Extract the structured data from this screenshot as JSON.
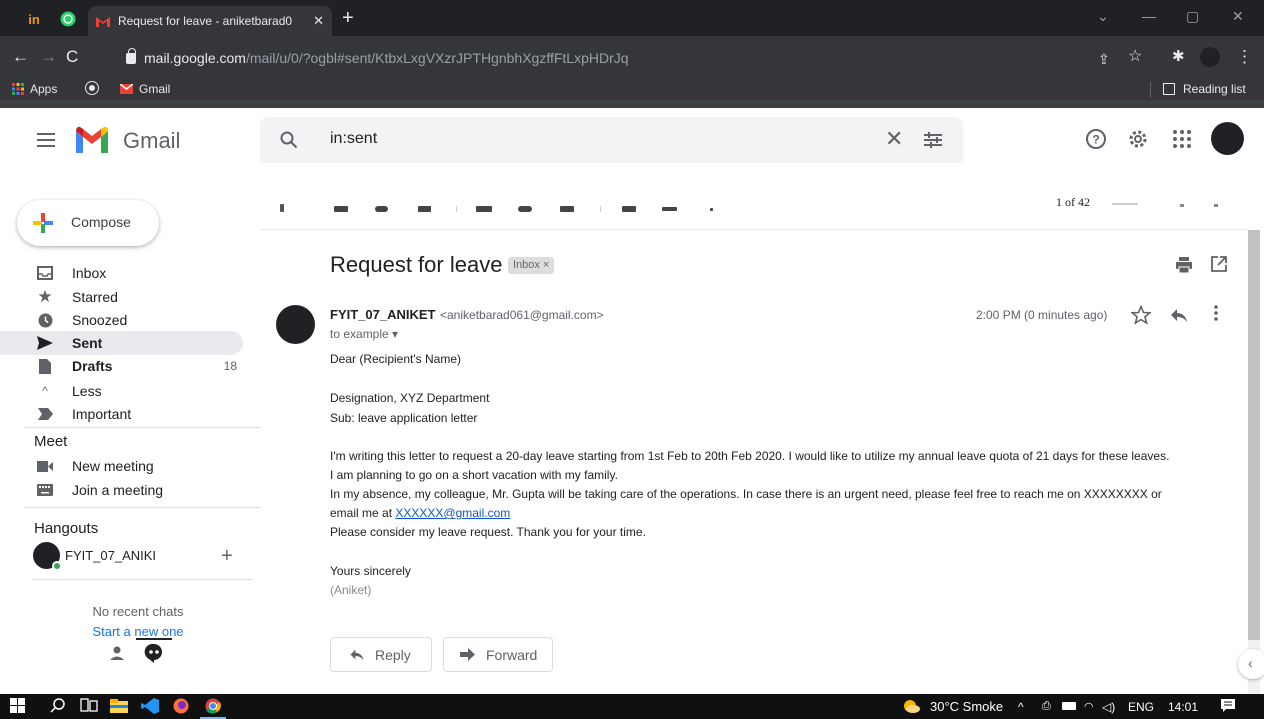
{
  "browser": {
    "tab_title": "Request for leave - aniketbarad0",
    "url_domain": "mail.google.com",
    "url_path": "/mail/u/0/?ogbl#sent/KtbxLxgVXzrJPTHgnbhXgzffFtLxpHDrJq",
    "bookmarks": {
      "apps": "Apps",
      "gmail": "Gmail",
      "reading_list": "Reading list"
    }
  },
  "gmail": {
    "app_name": "Gmail",
    "search_value": "in:sent",
    "compose_label": "Compose",
    "nav": [
      {
        "label": "Inbox",
        "count": ""
      },
      {
        "label": "Starred",
        "count": ""
      },
      {
        "label": "Snoozed",
        "count": ""
      },
      {
        "label": "Sent",
        "count": ""
      },
      {
        "label": "Drafts",
        "count": "18"
      },
      {
        "label": "Less",
        "count": ""
      },
      {
        "label": "Important",
        "count": ""
      }
    ],
    "meet": {
      "title": "Meet",
      "new_meeting": "New meeting",
      "join": "Join a meeting"
    },
    "hangouts": {
      "title": "Hangouts",
      "user": "FYIT_07_ANIKI",
      "no_chats": "No recent chats",
      "start_new": "Start a new one"
    },
    "pager": "1 of 42"
  },
  "email": {
    "subject": "Request for leave",
    "label_chip": "Inbox ×",
    "sender_name": "FYIT_07_ANIKET",
    "sender_email": "<aniketbarad061@gmail.com>",
    "to": "to example ▾",
    "time": "2:00 PM (0 minutes ago)",
    "greeting": "Dear (Recipient's Name)",
    "designation": "Designation, XYZ Department",
    "sub": "Sub: leave application letter",
    "para1": "I'm writing this letter to request a 20-day leave starting from 1st Feb  to 20th Feb 2020. I would like to utilize my annual leave quota of 21 days for these leaves.",
    "para2": "I am planning to go on a short vacation with my family.",
    "para3": "In my absence, my colleague, Mr. Gupta will be taking care of the operations. In case there is an urgent need, please feel free to reach me on XXXXXXXX or",
    "para4_prefix": "email me at ",
    "para4_link": "XXXXXX@gmail.com",
    "para5": "Please consider my leave request. Thank you for your time.",
    "closing": "Yours sincerely",
    "signature": "(Aniket)",
    "reply_label": "Reply",
    "forward_label": "Forward"
  },
  "taskbar": {
    "weather": "30°C  Smoke",
    "lang": "ENG",
    "clock": "14:01"
  }
}
